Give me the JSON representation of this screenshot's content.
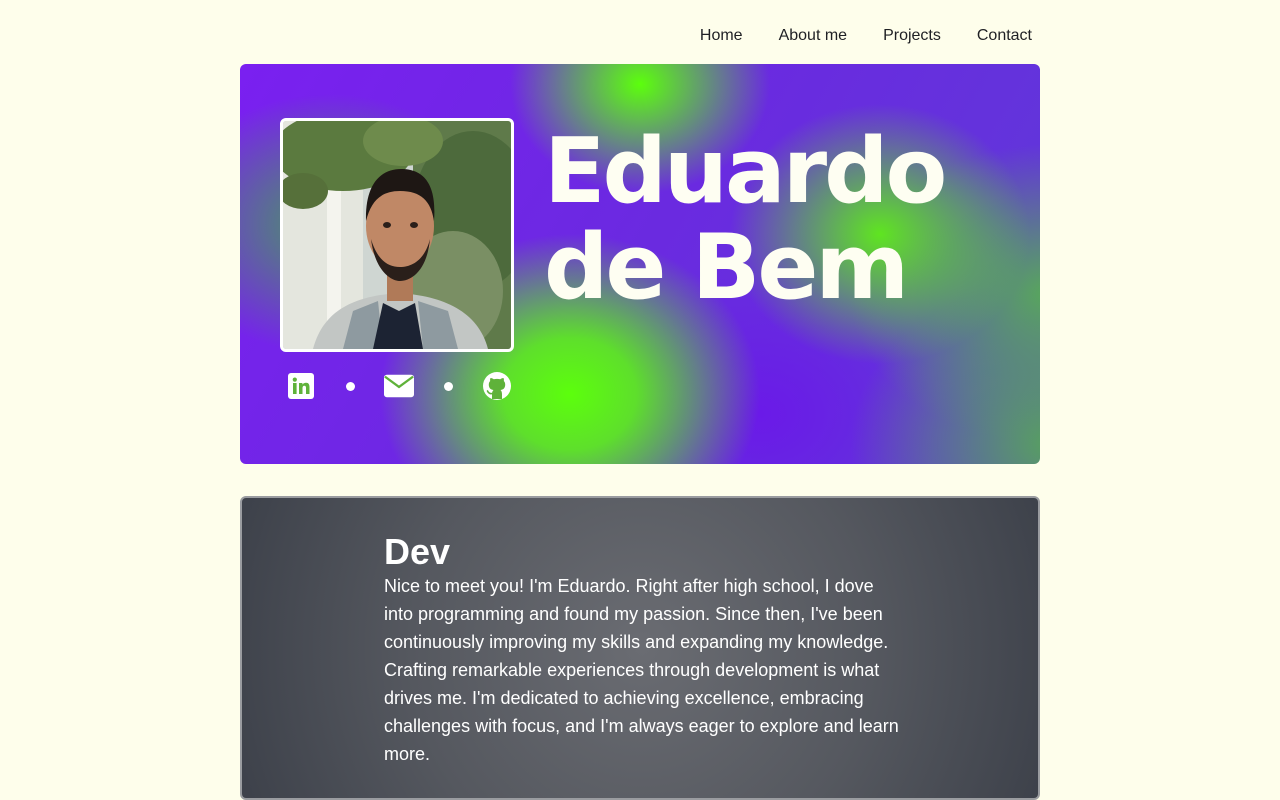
{
  "nav": {
    "items": [
      {
        "label": "Home"
      },
      {
        "label": "About me"
      },
      {
        "label": "Projects"
      },
      {
        "label": "Contact"
      }
    ]
  },
  "hero": {
    "name_line1": "Eduardo",
    "name_line2": "de Bem",
    "socials": [
      {
        "icon": "linkedin-icon"
      },
      {
        "icon": "email-icon"
      },
      {
        "icon": "github-icon"
      }
    ]
  },
  "about": {
    "title": "Dev",
    "text": "Nice to meet you! I'm Eduardo. Right after high school, I dove into programming and found my passion. Since then, I've been continuously improving my skills and expanding my knowledge. Crafting remarkable experiences through development is what drives me. I'm dedicated to achieving excellence, embracing challenges with focus, and I'm always eager to explore and learn more."
  },
  "colors": {
    "background": "#fefeeb",
    "accent_green": "#5cff0c",
    "accent_purple": "#6a1ae8",
    "card": "#55585f"
  }
}
